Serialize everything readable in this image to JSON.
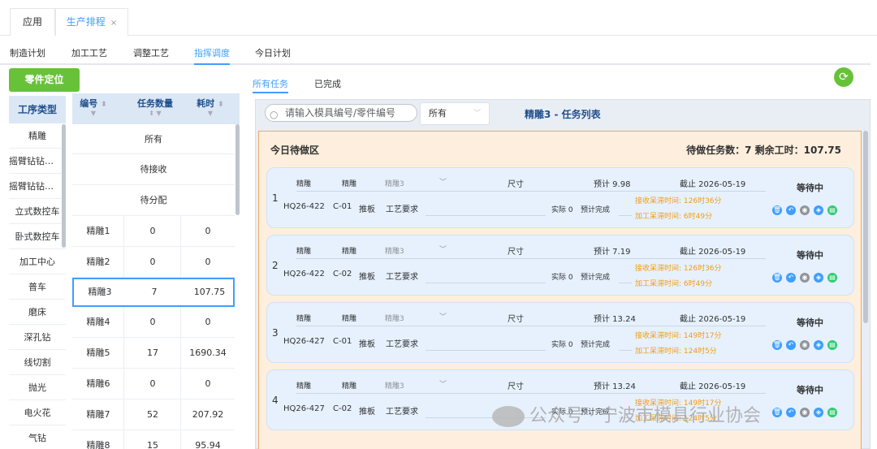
{
  "page_tabs": [
    {
      "label": "应用"
    },
    {
      "label": "生产排程",
      "close": "×"
    }
  ],
  "subnav": [
    "制造计划",
    "加工工艺",
    "调整工艺",
    "指挥调度",
    "今日计划"
  ],
  "locate_button": "零件定位",
  "process_types": {
    "header": "工序类型",
    "items": [
      "精雕",
      "摇臂钻钻…",
      "摇臂钻钻…",
      "立式数控车",
      "卧式数控车",
      "加工中心",
      "普车",
      "磨床",
      "深孔钻",
      "线切割",
      "抛光",
      "电火花",
      "气钻"
    ]
  },
  "task_table": {
    "headers": [
      "编号",
      "任务数量",
      "耗时"
    ],
    "merged_rows": [
      "所有",
      "待接收",
      "待分配"
    ],
    "rows": [
      {
        "code": "精雕1",
        "count": "0",
        "time": "0"
      },
      {
        "code": "精雕2",
        "count": "0",
        "time": "0"
      },
      {
        "code": "精雕3",
        "count": "7",
        "time": "107.75"
      },
      {
        "code": "精雕4",
        "count": "0",
        "time": "0"
      },
      {
        "code": "精雕5",
        "count": "17",
        "time": "1690.34"
      },
      {
        "code": "精雕6",
        "count": "0",
        "time": "0"
      },
      {
        "code": "精雕7",
        "count": "52",
        "time": "207.92"
      },
      {
        "code": "精雕8",
        "count": "15",
        "time": "95.94"
      }
    ]
  },
  "right_tabs": [
    "所有任务",
    "已完成"
  ],
  "search": {
    "placeholder": "请输入模具编号/零件编号",
    "filter": "所有"
  },
  "list_title": "精雕3 - 任务列表",
  "todo": {
    "title": "今日待做区",
    "stat": "待做任务数：7   剩余工时：107.75"
  },
  "cards": [
    {
      "idx": "1",
      "a": "精雕",
      "b": "精雕",
      "c": "精雕3",
      "chk": "尺寸",
      "plan": "预计 9.98",
      "due": "截止 2026-05-19",
      "status": "等待中",
      "mold": "HQ26-422",
      "part": "C-01",
      "name": "推板",
      "req": "工艺要求",
      "act": "实际 0",
      "pfin": "预计完成",
      "d1": "接收呆滞时间: 126时36分",
      "d2": "加工呆滞时间: 6时49分"
    },
    {
      "idx": "2",
      "a": "精雕",
      "b": "精雕",
      "c": "精雕3",
      "chk": "尺寸",
      "plan": "预计 7.19",
      "due": "截止 2026-05-19",
      "status": "等待中",
      "mold": "HQ26-422",
      "part": "C-02",
      "name": "推板",
      "req": "工艺要求",
      "act": "实际 0",
      "pfin": "预计完成",
      "d1": "接收呆滞时间: 126时36分",
      "d2": "加工呆滞时间: 6时49分"
    },
    {
      "idx": "3",
      "a": "精雕",
      "b": "精雕",
      "c": "精雕3",
      "chk": "尺寸",
      "plan": "预计 13.24",
      "due": "截止 2026-05-19",
      "status": "等待中",
      "mold": "HQ26-427",
      "part": "C-01",
      "name": "推板",
      "req": "工艺要求",
      "act": "实际 0",
      "pfin": "预计完成",
      "d1": "接收呆滞时间: 149时17分",
      "d2": "加工呆滞时间: 124时5分"
    },
    {
      "idx": "4",
      "a": "精雕",
      "b": "精雕",
      "c": "精雕3",
      "chk": "尺寸",
      "plan": "预计 13.24",
      "due": "截止 2026-05-19",
      "status": "等待中",
      "mold": "HQ26-427",
      "part": "C-02",
      "name": "推板",
      "req": "工艺要求",
      "act": "实际 0",
      "pfin": "预计完成",
      "d1": "接收呆滞时间: 149时17分",
      "d2": "加工呆滞时间: 124时5分"
    }
  ],
  "icons": {
    "colors": [
      "#409eff",
      "#409eff",
      "#909399",
      "#409eff",
      "#2ecc71"
    ]
  },
  "watermark": "公众号 · 宁波市模具行业协会"
}
